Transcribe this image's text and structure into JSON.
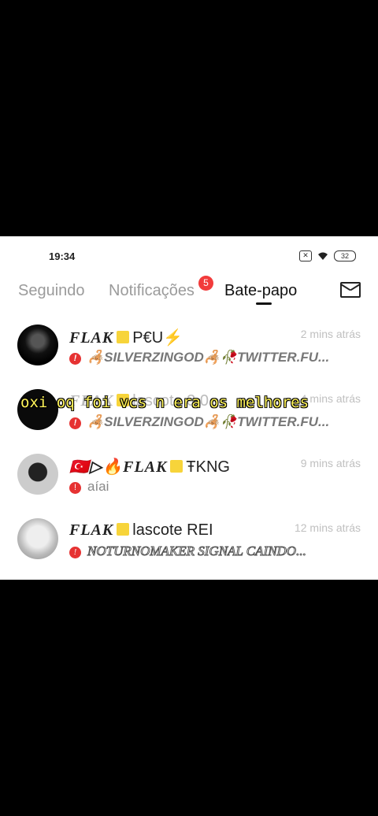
{
  "status": {
    "time": "19:34",
    "battery": "32"
  },
  "tabs": [
    {
      "label": "Seguindo"
    },
    {
      "label": "Notificações"
    },
    {
      "label": "Bate-papo"
    }
  ],
  "notifications_badge": "5",
  "chats": [
    {
      "name_prefix": "FLAK",
      "name_suffix": "P€U⚡",
      "time": "2 mins atrás",
      "preview": "🦂SILVERZINGOD🦂🥀TWITTER.FU..."
    },
    {
      "name_prefix": "FLAK",
      "name_suffix": "lascote 3.0",
      "time": "4 mins atrás",
      "preview": "🦂SILVERZINGOD🦂🥀TWITTER.FU..."
    },
    {
      "name_prefix": "🇹🇷▷🔥FLAK",
      "name_suffix": "ŦKNG",
      "time": "9 mins atrás",
      "preview": "aíai"
    },
    {
      "name_prefix": "FLAK",
      "name_suffix": "lascote REI",
      "time": "12 mins atrás",
      "preview": "NOTURNOMAKER SIGNAL CAINDO..."
    }
  ],
  "overlay_caption": "oxi oq foi vcs n era os melhores",
  "colors": {
    "badge": "#f23b3b",
    "caption": "#fff45a"
  }
}
